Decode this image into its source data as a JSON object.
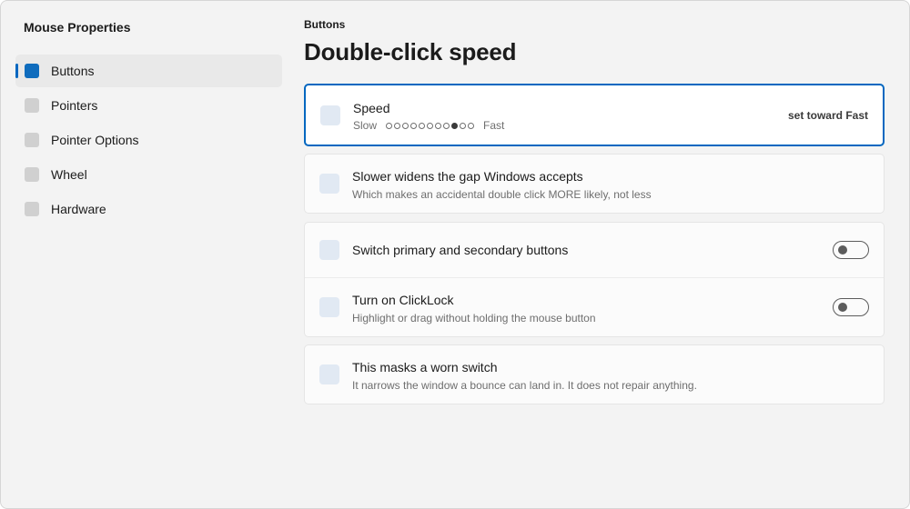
{
  "app": {
    "title": "Mouse Properties"
  },
  "sidebar": {
    "items": [
      {
        "label": "Buttons",
        "active": true
      },
      {
        "label": "Pointers",
        "active": false
      },
      {
        "label": "Pointer Options",
        "active": false
      },
      {
        "label": "Wheel",
        "active": false
      },
      {
        "label": "Hardware",
        "active": false
      }
    ]
  },
  "main": {
    "breadcrumb": "Buttons",
    "title": "Double-click speed",
    "speed": {
      "title": "Speed",
      "slow_label": "Slow",
      "fast_label": "Fast",
      "total_steps": 11,
      "selected_step": 9,
      "action_label": "set toward Fast"
    },
    "gap_note": {
      "title": "Slower widens the gap Windows accepts",
      "subtitle": "Which makes an accidental double click MORE likely, not less"
    },
    "switch_buttons": {
      "title": "Switch primary and secondary buttons",
      "on": false
    },
    "clicklock": {
      "title": "Turn on ClickLock",
      "subtitle": "Highlight or drag without holding the mouse button",
      "on": false
    },
    "worn_switch": {
      "title": "This masks a worn switch",
      "subtitle": "It narrows the window a bounce can land in. It does not repair anything."
    }
  },
  "colors": {
    "accent": "#0067c0",
    "window_bg": "#f3f3f3",
    "card_bg": "#fbfbfb"
  },
  "icons": {
    "nav": "square-icon",
    "row": "setting-icon"
  }
}
